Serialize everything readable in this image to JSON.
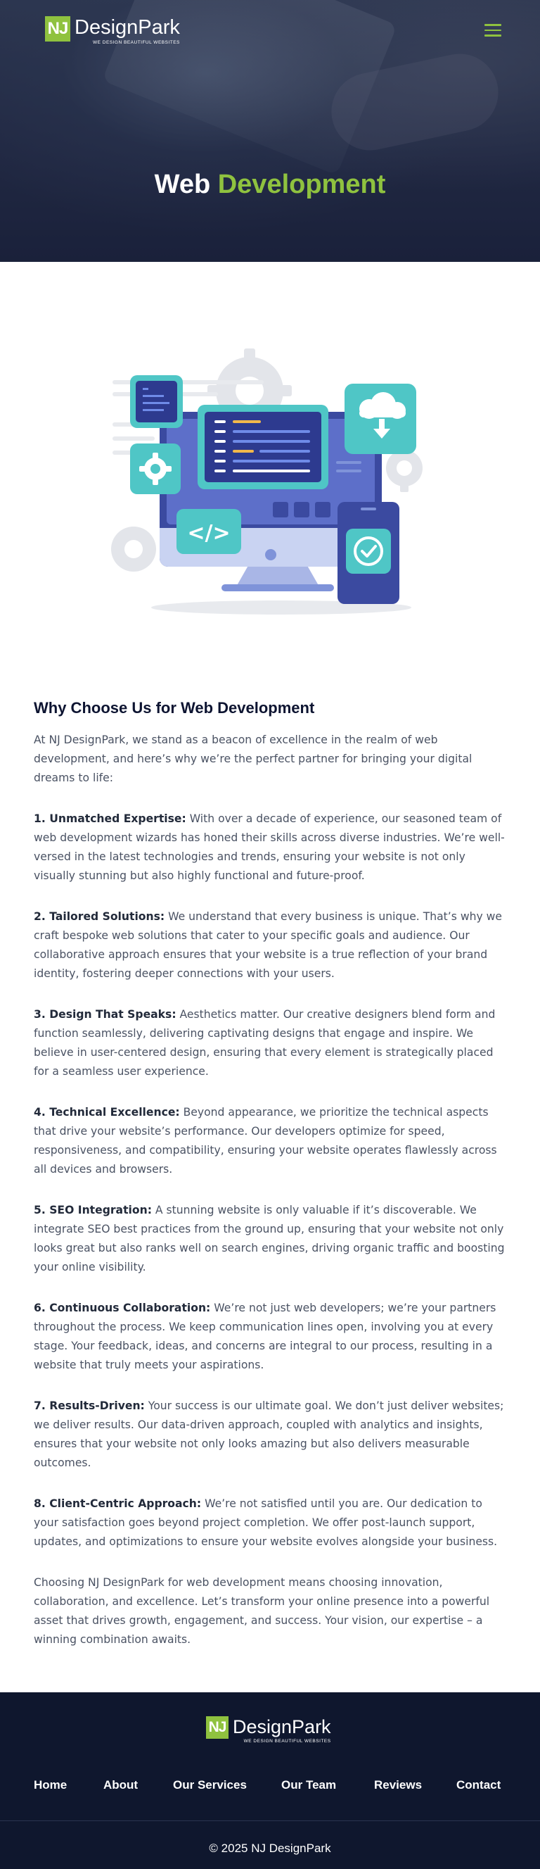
{
  "brand": {
    "logo_mark": "NJ",
    "name": "DesignPark",
    "tagline": "WE DESIGN BEAUTIFUL WEBSITES"
  },
  "header": {
    "menu_icon": "hamburger-menu-icon"
  },
  "hero": {
    "title_part1": "Web",
    "title_part2": "Development"
  },
  "colors": {
    "accent": "#8fc23f",
    "dark_navy": "#0f172e",
    "heading": "#0d1431",
    "teal": "#3ec4c4",
    "indigo": "#3b4aa0"
  },
  "content": {
    "heading": "Why Choose Us for Web Development",
    "intro": "At NJ DesignPark, we stand as a beacon of excellence in the realm of web development, and here’s why we’re the perfect partner for bringing your digital dreams to life:",
    "points": [
      {
        "title": "1. Unmatched Expertise:",
        "text": " With over a decade of experience, our seasoned team of web development wizards has honed their skills across diverse industries. We’re well-versed in the latest technologies and trends, ensuring your website is not only visually stunning but also highly functional and future-proof."
      },
      {
        "title": "2. Tailored Solutions:",
        "text": " We understand that every business is unique. That’s why we craft bespoke web solutions that cater to your specific goals and audience. Our collaborative approach ensures that your website is a true reflection of your brand identity, fostering deeper connections with your users."
      },
      {
        "title": "3. Design That Speaks:",
        "text": " Aesthetics matter. Our creative designers blend form and function seamlessly, delivering captivating designs that engage and inspire. We believe in user-centered design, ensuring that every element is strategically placed for a seamless user experience."
      },
      {
        "title": "4. Technical Excellence:",
        "text": " Beyond appearance, we prioritize the technical aspects that drive your website’s performance. Our developers optimize for speed, responsiveness, and compatibility, ensuring your website operates flawlessly across all devices and browsers."
      },
      {
        "title": "5. SEO Integration:",
        "text": " A stunning website is only valuable if it’s discoverable. We integrate SEO best practices from the ground up, ensuring that your website not only looks great but also ranks well on search engines, driving organic traffic and boosting your online visibility."
      },
      {
        "title": "6. Continuous Collaboration:",
        "text": " We’re not just web developers; we’re your partners throughout the process. We keep communication lines open, involving you at every stage. Your feedback, ideas, and concerns are integral to our process, resulting in a website that truly meets your aspirations."
      },
      {
        "title": "7. Results-Driven:",
        "text": " Your success is our ultimate goal. We don’t just deliver websites; we deliver results. Our data-driven approach, coupled with analytics and insights, ensures that your website not only looks amazing but also delivers measurable outcomes."
      },
      {
        "title": "8. Client-Centric Approach:",
        "text": " We’re not satisfied until you are. Our dedication to your satisfaction goes beyond project completion. We offer post-launch support, updates, and optimizations to ensure your website evolves alongside your business."
      }
    ],
    "closing": "Choosing NJ DesignPark for web development means choosing innovation, collaboration, and excellence. Let’s transform your online presence into a powerful asset that drives growth, engagement, and success. Your vision, our expertise – a winning combination awaits."
  },
  "footer": {
    "nav": [
      "Home",
      "About",
      "Our Services",
      "Our Team",
      "Reviews",
      "Contact"
    ],
    "copyright": "© 2025 NJ DesignPark"
  }
}
